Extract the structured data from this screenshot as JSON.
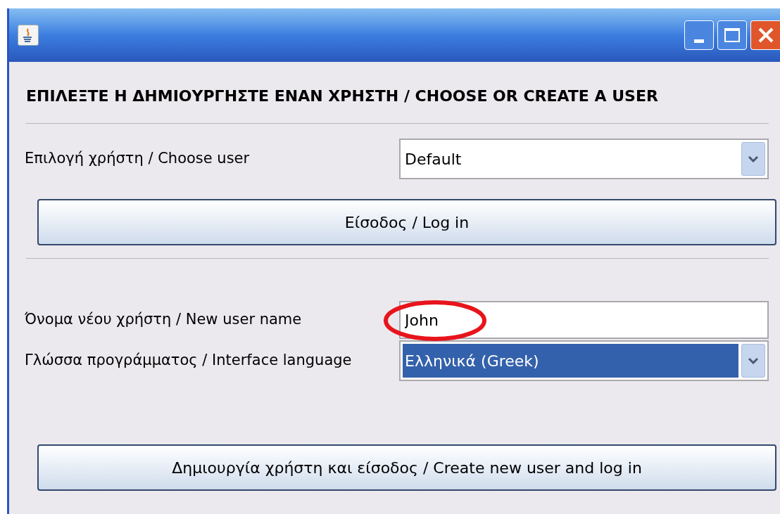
{
  "window": {
    "title_buttons": [
      {
        "kind": "minimize"
      },
      {
        "kind": "maximize"
      },
      {
        "kind": "close"
      }
    ]
  },
  "heading": "ΕΠΙΛΕΞΤΕ Η ΔΗΜΙΟΥΡΓΗΣΤΕ ΕΝΑΝ ΧΡΗΣΤΗ / CHOOSE OR CREATE A USER",
  "choose_user": {
    "label": "Επιλογή χρήστη / Choose user",
    "value": "Default",
    "highlighted": false
  },
  "login_button": "Είσοδος / Log in",
  "new_user_name": {
    "label": "Όνομα νέου χρήστη / New user name",
    "value": "John",
    "circled": true
  },
  "language": {
    "label": "Γλώσσα προγράμματος / Interface language",
    "value": "Ελληνικά (Greek)",
    "highlighted": true
  },
  "create_button": "Δημιουργία χρήστη και είσοδος / Create new user and log in"
}
